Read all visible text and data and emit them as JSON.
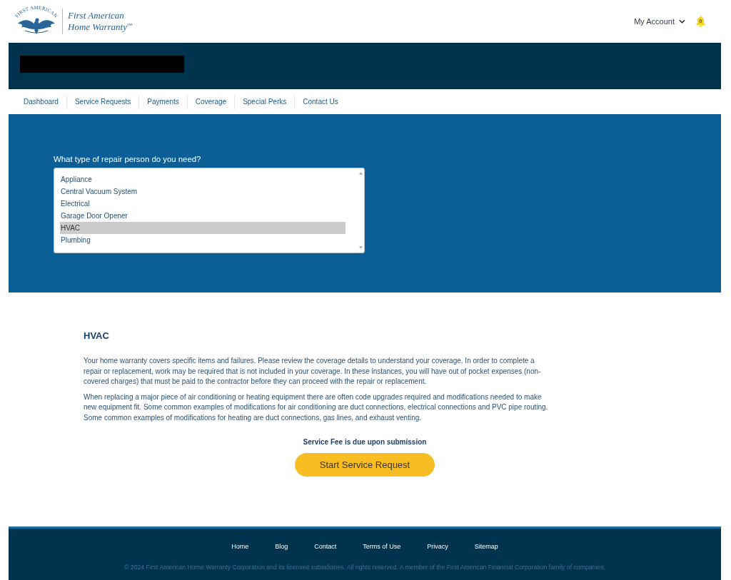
{
  "header": {
    "logo": {
      "arc_text": "FIRST AMERICAN",
      "line_1": "First American",
      "line_2": "Home Warranty$^{SM}$"
    },
    "account_menu": {
      "label": "My Account"
    },
    "notifications": {
      "count": "0"
    }
  },
  "nav": {
    "items": [
      {
        "label": "Dashboard"
      },
      {
        "label": "Service Requests"
      },
      {
        "label": "Payments"
      },
      {
        "label": "Coverage"
      },
      {
        "label": "Special Perks"
      },
      {
        "label": "Contact Us"
      }
    ]
  },
  "repair_picker": {
    "question": "What type of repair person do you need?",
    "options": [
      {
        "label": "Appliance",
        "selected": false
      },
      {
        "label": "Central Vacuum System",
        "selected": false
      },
      {
        "label": "Electrical",
        "selected": false
      },
      {
        "label": "Garage Door Opener",
        "selected": false
      },
      {
        "label": "HVAC",
        "selected": true
      },
      {
        "label": "Plumbing",
        "selected": false
      }
    ]
  },
  "details": {
    "title": "HVAC",
    "paragraphs": [
      "Your home warranty covers specific items and failures. Please review the coverage details to understand your coverage. In order to complete a repair or replacement, work may be required that is not included in your coverage. In these instances, you will have out of pocket expenses (non-covered charges) that must be paid to the contractor before they can proceed with the repair or replacement.",
      "When replacing a major piece of air conditioning or heating equipment there are often code upgrades required and modifications needed to make new equipment fit. Some common examples of modifications for air conditioning are duct connections, electrical connections and PVC pipe routing. Some common examples of modifications for heating are duct connections, gas lines, and exhaust venting."
    ],
    "fee_note": "Service Fee is due upon submission",
    "button": "Start Service Request"
  },
  "footer": {
    "links": [
      "Home",
      "Blog",
      "Contact",
      "Terms of Use",
      "Privacy",
      "Sitemap"
    ],
    "copyright": "© 2024 First American Home Warranty Corporation and its licensed subsidiaries. All rights reserved. A member of the First American Financial Corporation family of companies."
  }
}
